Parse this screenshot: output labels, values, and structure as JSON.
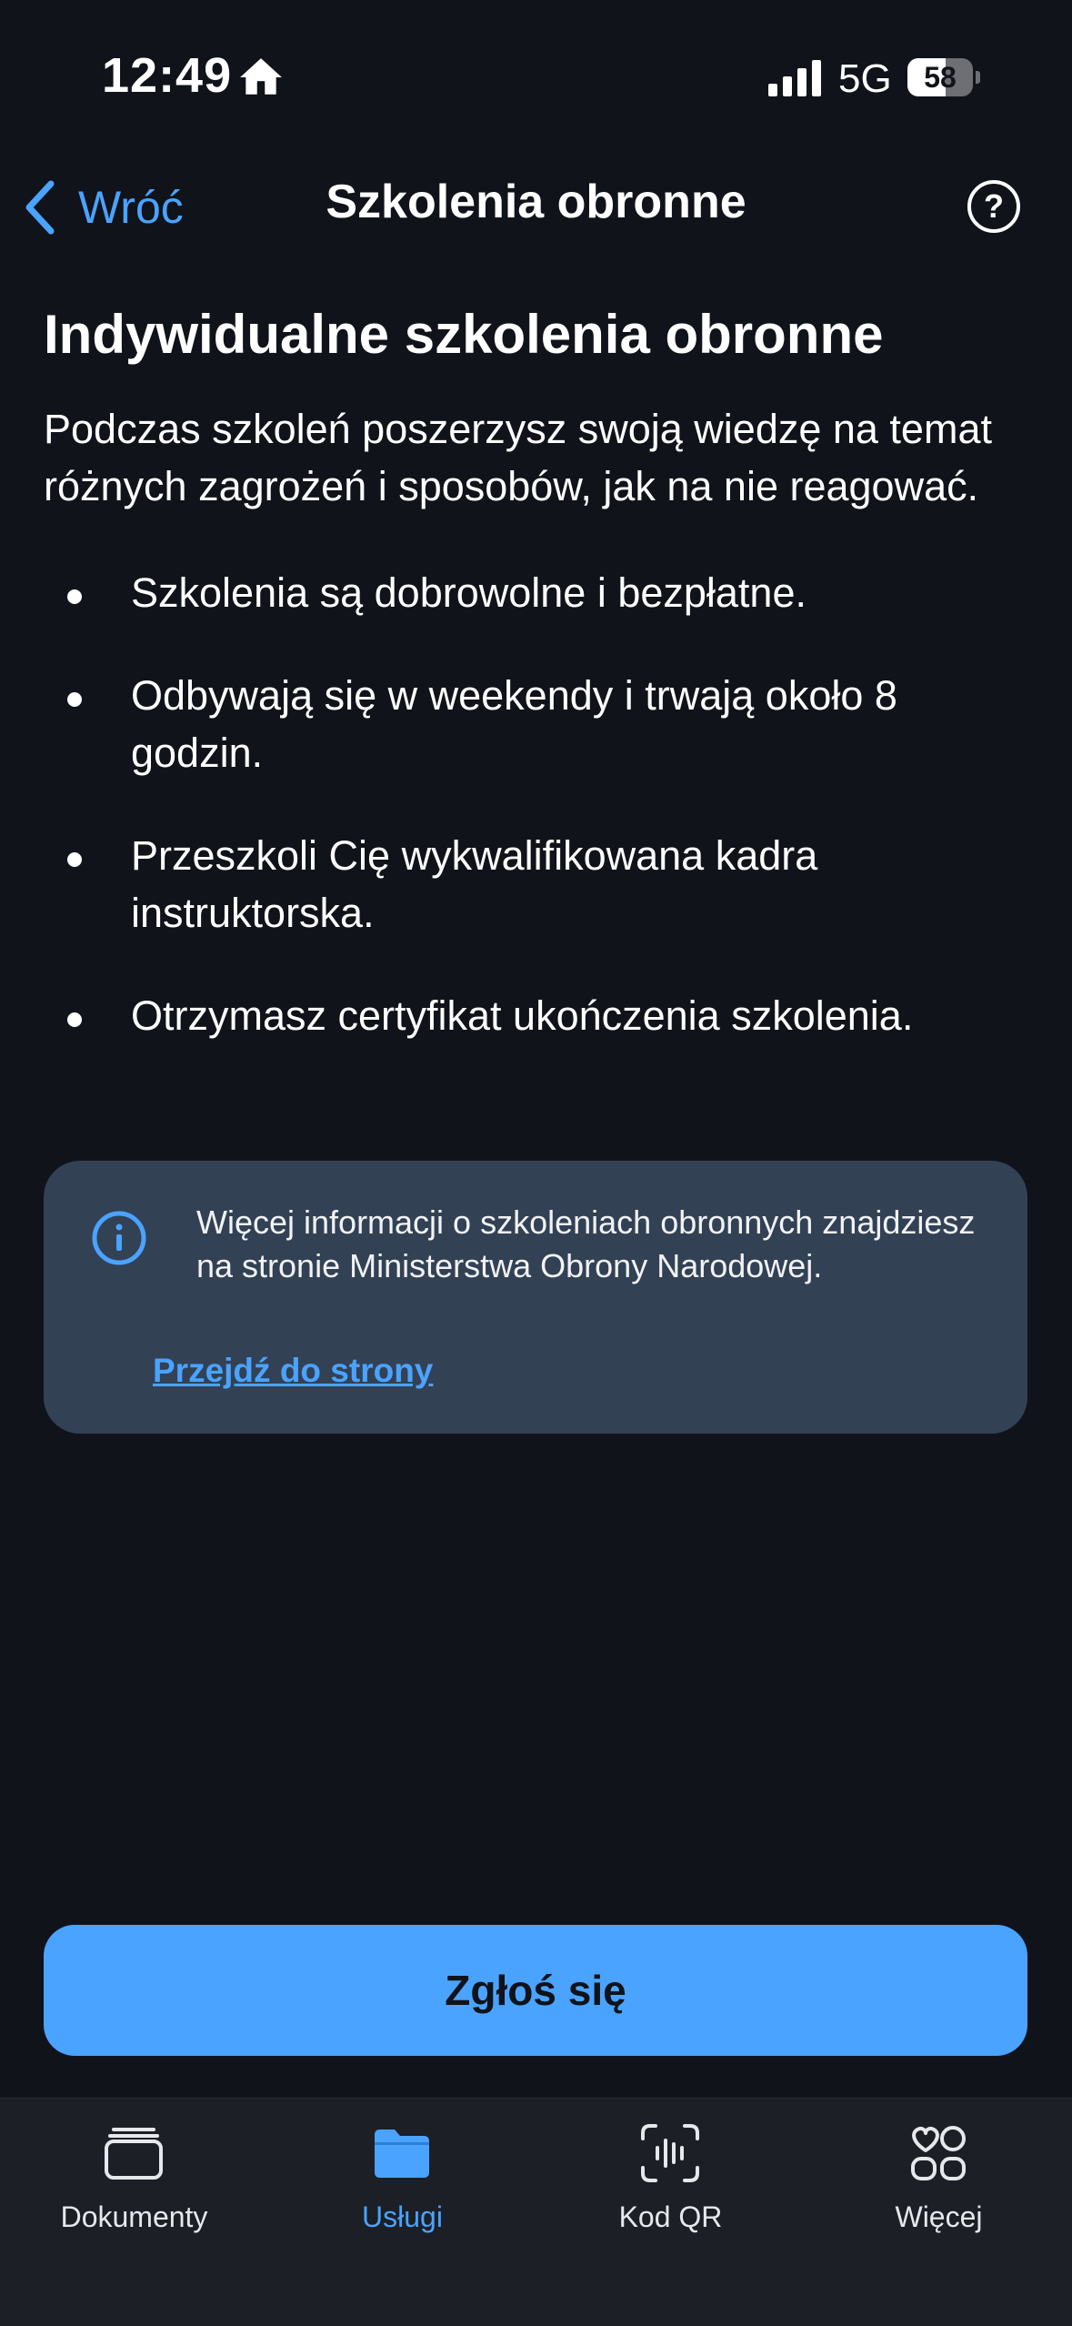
{
  "status_bar": {
    "time": "12:49",
    "network": "5G",
    "battery": "58",
    "battery_fraction": 0.58
  },
  "nav": {
    "back_label": "Wróć",
    "title": "Szkolenia obronne",
    "help_label": "?"
  },
  "content": {
    "heading": "Indywidualne szkolenia obronne",
    "intro": "Podczas szkoleń poszerzysz swoją wiedzę na temat różnych zagrożeń i sposobów, jak na nie reagować.",
    "bullets": [
      "Szkolenia są dobrowolne i bezpłatne.",
      "Odbywają się w weekendy i trwają około 8 godzin.",
      "Przeszkoli Cię wykwalifikowana kadra instruktorska.",
      "Otrzymasz certyfikat ukończenia szkolenia."
    ]
  },
  "info": {
    "text": "Więcej informacji o szkoleniach obronnych znajdziesz na stronie Ministerstwa Obrony Narodowej.",
    "link": "Przejdź do strony"
  },
  "cta": {
    "label": "Zgłoś się"
  },
  "tabs": [
    {
      "label": "Dokumenty",
      "icon": "documents-icon",
      "active": false
    },
    {
      "label": "Usługi",
      "icon": "folder-icon",
      "active": true
    },
    {
      "label": "Kod QR",
      "icon": "qr-scan-icon",
      "active": false
    },
    {
      "label": "Więcej",
      "icon": "more-icon",
      "active": false
    }
  ],
  "colors": {
    "background": "#10131a",
    "accent": "#4aa3ff",
    "card": "#334155",
    "tabbar": "#1c1f26"
  }
}
